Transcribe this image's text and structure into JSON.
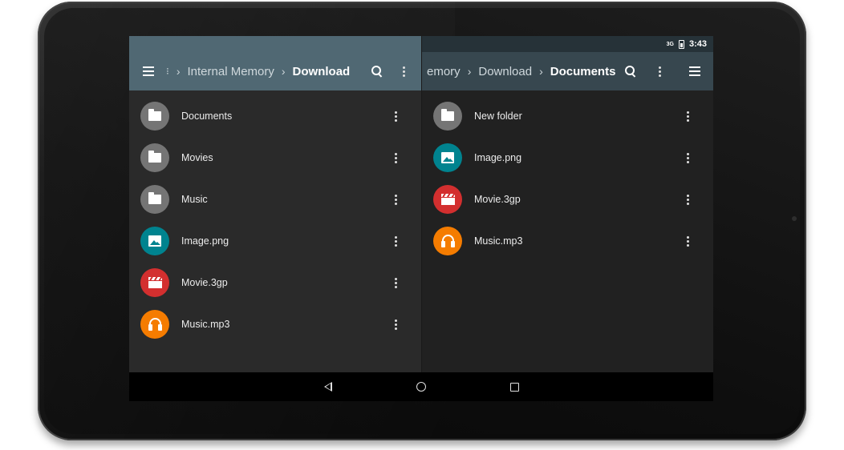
{
  "status_bar": {
    "signal_label": "3G",
    "time": "3:43"
  },
  "left_pane": {
    "breadcrumbs": [
      {
        "label": "Internal Memory",
        "active": false
      },
      {
        "label": "Download",
        "active": true
      }
    ],
    "overflow_crumb": "›",
    "items": [
      {
        "label": "Documents",
        "type": "folder",
        "icon": "folder-icon",
        "color": "#757575"
      },
      {
        "label": "Movies",
        "type": "folder",
        "icon": "folder-icon",
        "color": "#757575"
      },
      {
        "label": "Music",
        "type": "folder",
        "icon": "folder-icon",
        "color": "#757575"
      },
      {
        "label": "Image.png",
        "type": "image",
        "icon": "image-icon",
        "color": "#00838f"
      },
      {
        "label": "Movie.3gp",
        "type": "video",
        "icon": "clapperboard-icon",
        "color": "#d32f2f"
      },
      {
        "label": "Music.mp3",
        "type": "audio",
        "icon": "headphones-icon",
        "color": "#f57c00"
      }
    ]
  },
  "right_pane": {
    "breadcrumbs": [
      {
        "label": "emory",
        "active": false
      },
      {
        "label": "Download",
        "active": false
      },
      {
        "label": "Documents",
        "active": true
      }
    ],
    "items": [
      {
        "label": "New folder",
        "type": "folder",
        "icon": "folder-icon",
        "color": "#757575"
      },
      {
        "label": "Image.png",
        "type": "image",
        "icon": "image-icon",
        "color": "#00838f"
      },
      {
        "label": "Movie.3gp",
        "type": "video",
        "icon": "clapperboard-icon",
        "color": "#d32f2f"
      },
      {
        "label": "Music.mp3",
        "type": "audio",
        "icon": "headphones-icon",
        "color": "#f57c00"
      }
    ]
  },
  "nav_bar": {
    "buttons": [
      "back-icon",
      "home-icon",
      "recents-icon"
    ]
  },
  "colors": {
    "toolbar_left": "#546e7a",
    "toolbar_right": "#37474f",
    "list_bg": "#212121",
    "folder": "#757575",
    "image": "#00838f",
    "video": "#d32f2f",
    "audio": "#f57c00"
  }
}
